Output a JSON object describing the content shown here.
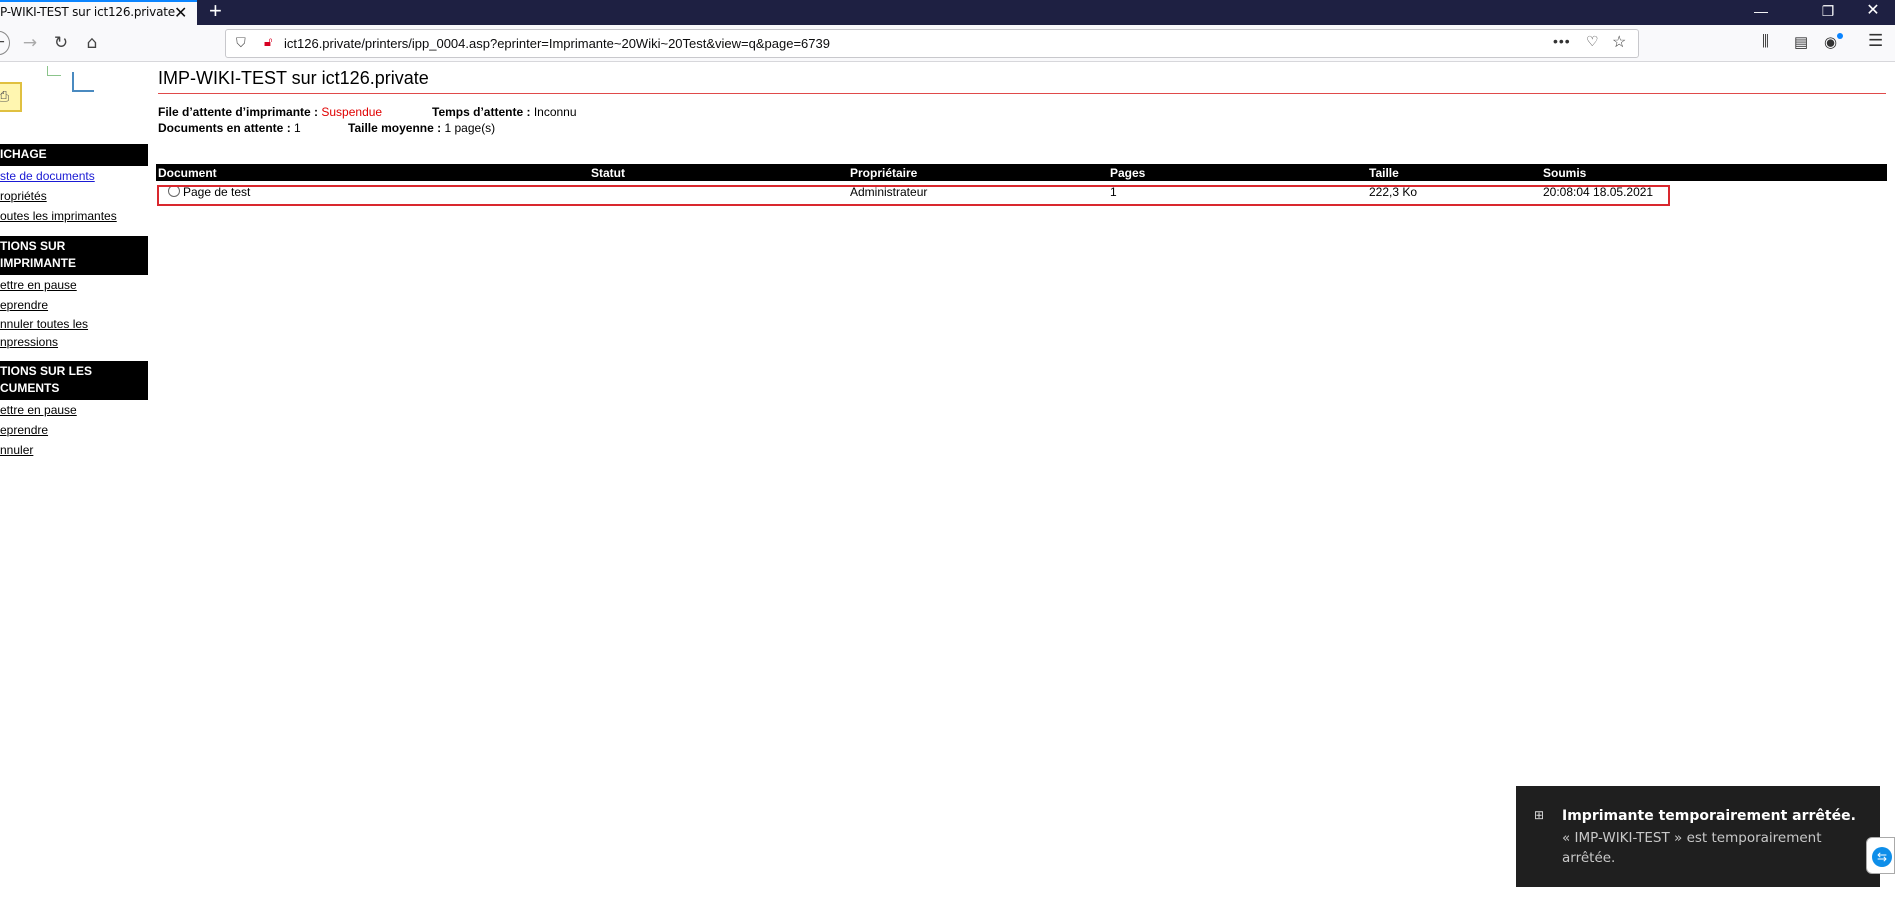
{
  "browser": {
    "tab_title": "P-WIKI-TEST sur ict126.private",
    "url": "ict126.private/printers/ipp_0004.asp?eprinter=Imprimante~20Wiki~20Test&view=q&page=6739"
  },
  "sidebar": {
    "section_display": "ICHAGE",
    "display_links": [
      "ste de documents",
      "ropriétés",
      "outes les imprimantes"
    ],
    "section_printer_actions": "TIONS SUR IMPRIMANTE",
    "printer_links": [
      "ettre en pause",
      "eprendre",
      "nnuler toutes les npressions"
    ],
    "section_document_actions": "TIONS SUR LES CUMENTS",
    "document_links": [
      "ettre en pause",
      "eprendre",
      "nnuler"
    ]
  },
  "page": {
    "title": "IMP-WIKI-TEST sur ict126.private",
    "queue_label": "File d’attente d’imprimante :",
    "queue_value": "Suspendue",
    "wait_label": "Temps d’attente :",
    "wait_value": "Inconnu",
    "docs_label": "Documents en attente :",
    "docs_value": "1",
    "avg_label": "Taille moyenne :",
    "avg_value": "1 page(s)"
  },
  "table": {
    "headers": [
      "Document",
      "Statut",
      "Propriétaire",
      "Pages",
      "Taille",
      "Soumis"
    ],
    "rows": [
      {
        "document": "Page de test",
        "status": "",
        "owner": "Administrateur",
        "pages": "1",
        "size": "222,3 Ko",
        "submitted": "20:08:04 18.05.2021"
      }
    ]
  },
  "toast": {
    "title": "Imprimante temporairement arrêtée.",
    "body": "« IMP-WIKI-TEST » est temporairement arrêtée."
  },
  "colors": {
    "accent": "#0a84ff",
    "status_red": "#e00000",
    "highlight": "#d9282e",
    "titlebar": "#1e2042"
  }
}
